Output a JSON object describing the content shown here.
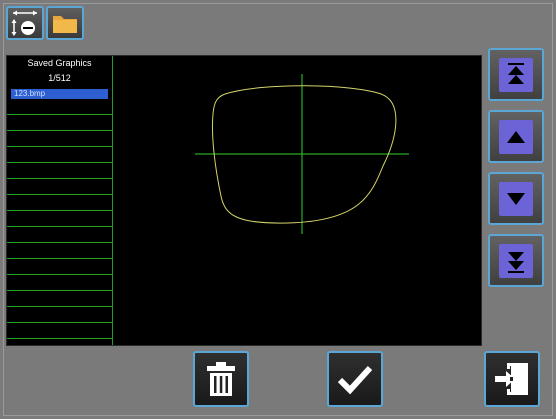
{
  "list": {
    "title": "Saved Graphics",
    "count": "1/512",
    "items": [
      "123.bmp"
    ]
  },
  "colors": {
    "background": "#7b7b7b",
    "panel": "#000000",
    "grid_lines": "#1fa31f",
    "shape_outline": "#d6d46a",
    "crosshair": "#2fd12f",
    "selection": "#2e5fd0",
    "nav_button_face": "#6b63d6",
    "button_border": "#5aa6d4"
  },
  "icons": {
    "top_left": "measure-icon",
    "top_second": "folder-icon",
    "nav": [
      "page-up-icon",
      "up-icon",
      "down-icon",
      "page-down-icon"
    ],
    "bottom": [
      "trash-icon",
      "check-icon",
      "exit-icon"
    ]
  }
}
